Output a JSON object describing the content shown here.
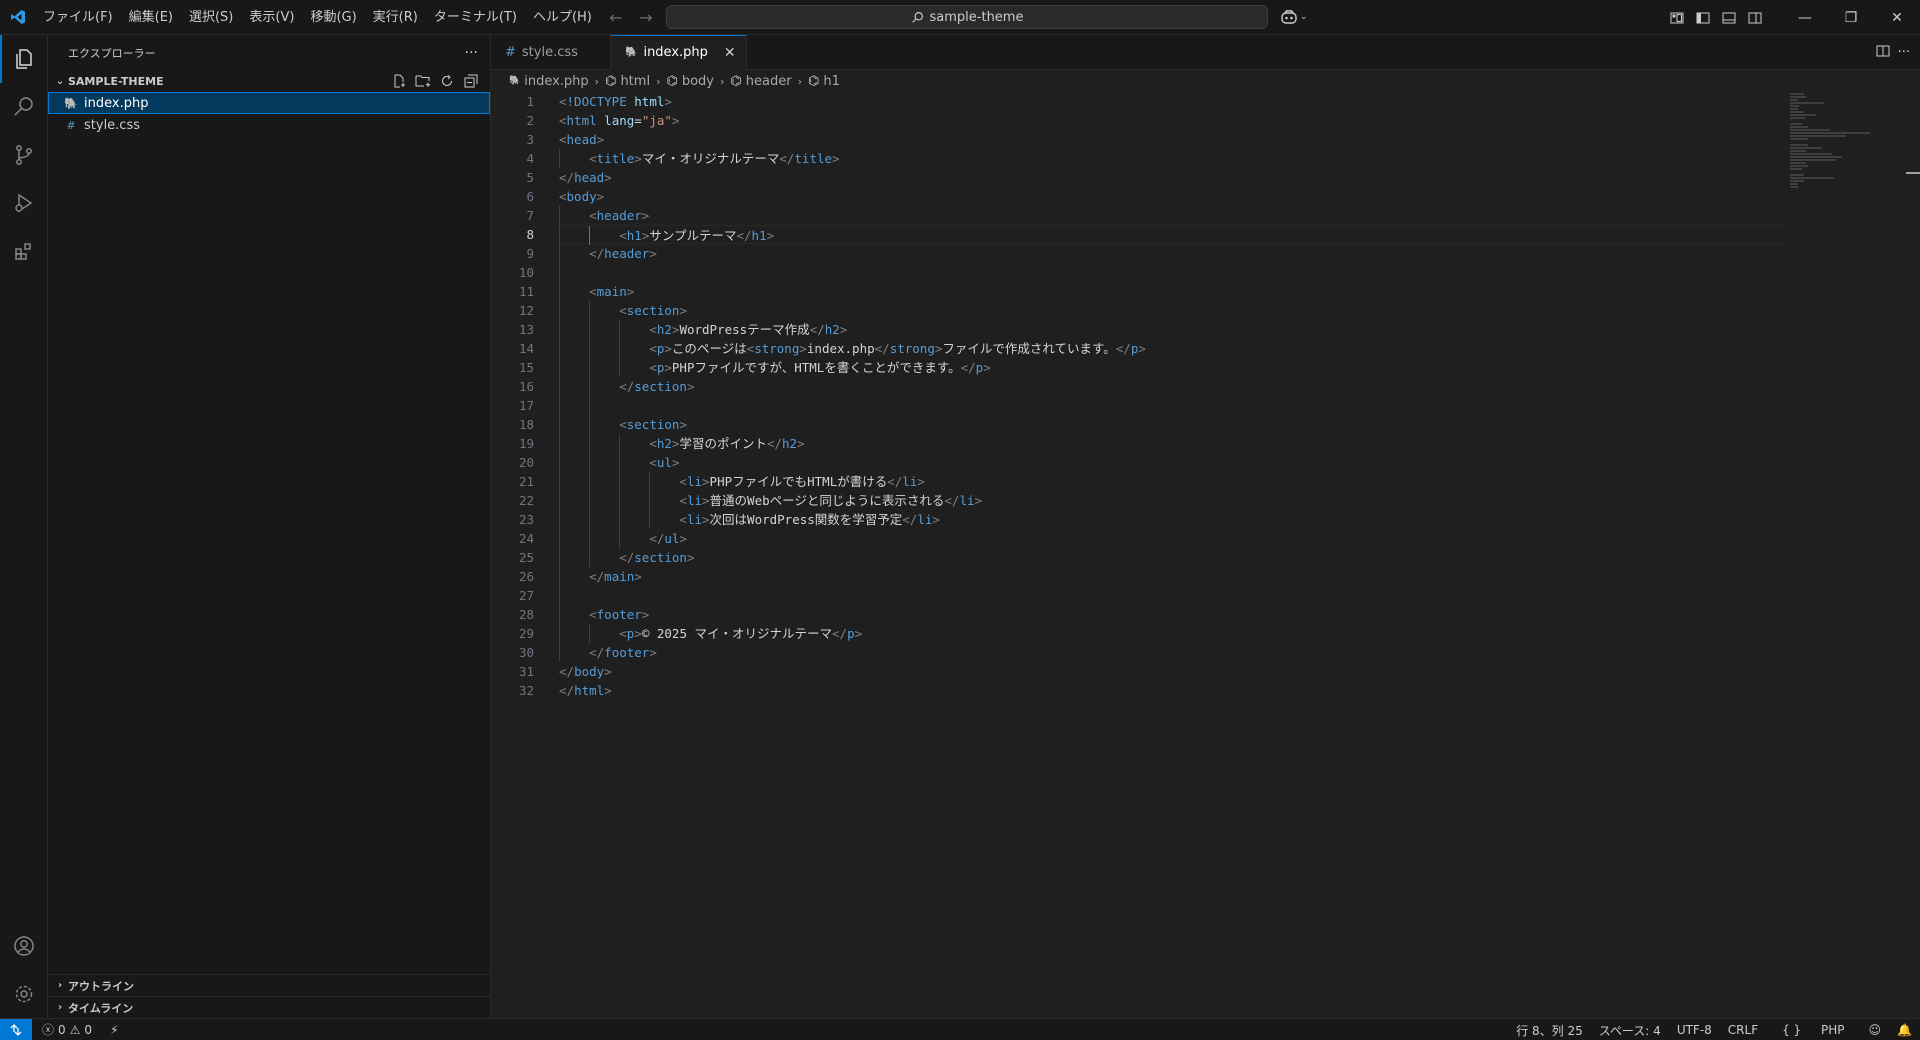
{
  "titlebar": {
    "menu": [
      "ファイル(F)",
      "編集(E)",
      "選択(S)",
      "表示(V)",
      "移動(G)",
      "実行(R)",
      "ターミナル(T)",
      "ヘルプ(H)"
    ],
    "search": "sample-theme"
  },
  "sidebar": {
    "title": "エクスプローラー",
    "more": "···",
    "folder": "SAMPLE-THEME",
    "files": [
      {
        "name": "index.php",
        "icon": "php-file-icon",
        "selected": true
      },
      {
        "name": "style.css",
        "icon": "css-file-icon",
        "selected": false
      }
    ],
    "outline": "アウトライン",
    "timeline": "タイムライン"
  },
  "tabs": [
    {
      "label": "style.css",
      "active": false
    },
    {
      "label": "index.php",
      "active": true
    }
  ],
  "breadcrumbs": [
    "index.php",
    "html",
    "body",
    "header",
    "h1"
  ],
  "editor": {
    "current_line": 8,
    "line_numbers": [
      "1",
      "2",
      "3",
      "4",
      "5",
      "6",
      "7",
      "8",
      "9",
      "10",
      "11",
      "12",
      "13",
      "14",
      "15",
      "16",
      "17",
      "18",
      "19",
      "20",
      "21",
      "22",
      "23",
      "24",
      "25",
      "26",
      "27",
      "28",
      "29",
      "30",
      "31",
      "32"
    ]
  },
  "code": {
    "l1": "!DOCTYPE",
    "l1b": " html",
    "l2_attr": " lang",
    "l2_val": "\"ja\"",
    "title_text": "マイ・オリジナルテーマ",
    "h1_text": "サンプルテーマ",
    "h2a_text": "WordPressテーマ作成",
    "p1_a": "このページは",
    "p1_strong": "index.php",
    "p1_b": "ファイルで作成されています。",
    "p2_text": "PHPファイルですが、HTMLを書くことができます。",
    "h2b_text": "学習のポイント",
    "li1": "PHPファイルでもHTMLが書ける",
    "li2": "普通のWebページと同じように表示される",
    "li3": "次回はWordPress関数を学習予定",
    "footer_text": "© 2025 マイ・オリジナルテーマ"
  },
  "status": {
    "errors": "0",
    "warnings": "0",
    "position": "行 8、列 25",
    "spaces": "スペース: 4",
    "encoding": "UTF-8",
    "eol": "CRLF",
    "language": "PHP"
  },
  "colors": {
    "accent": "#0078d4",
    "tag": "#569cd6",
    "bracket": "#808080",
    "attribute": "#9cdcfe",
    "string": "#ce9178"
  }
}
